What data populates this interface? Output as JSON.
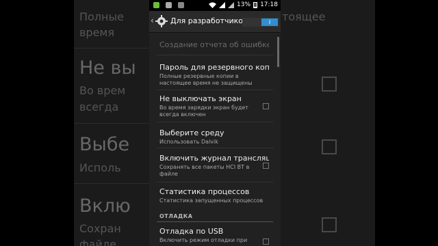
{
  "statusbar": {
    "battery": "13%",
    "time": "17:18"
  },
  "actionbar": {
    "title": "Для разработчиков",
    "toggle_label": "I"
  },
  "items": [
    {
      "title": "Создание отчета об ошибке",
      "subtitle": "",
      "disabled": true,
      "checkbox": false
    },
    {
      "title": "Пароль для резервного копирования",
      "subtitle": "Полные резервные копии в настоящее время не защищены",
      "checkbox": false
    },
    {
      "title": "Не выключать экран",
      "subtitle": "Во время зарядки экран будет всегда включен",
      "checkbox": true
    },
    {
      "title": "Выберите среду",
      "subtitle": "Использовать Dalvik",
      "checkbox": false
    },
    {
      "title": "Включить журнал трансляции",
      "subtitle": "Сохранять все пакеты HCI BT в файле",
      "checkbox": true
    },
    {
      "title": "Статистика процессов",
      "subtitle": "Статистика запущенных процессов",
      "checkbox": false
    }
  ],
  "section": {
    "label": "ОТЛАДКА"
  },
  "usb_item": {
    "title": "Отладка по USB",
    "subtitle": "Включить режим отладки при"
  },
  "background": {
    "left": {
      "row1": "Полные",
      "row1b": "время",
      "row2": "Не вы",
      "row2a": "Во врем",
      "row2b": "всегда",
      "row3": "Выбе",
      "row3a": "Исполь",
      "row4": "Вклю",
      "row4a": "Сохран",
      "row4b": "файле"
    },
    "right": {
      "row1": "тоящее"
    }
  }
}
